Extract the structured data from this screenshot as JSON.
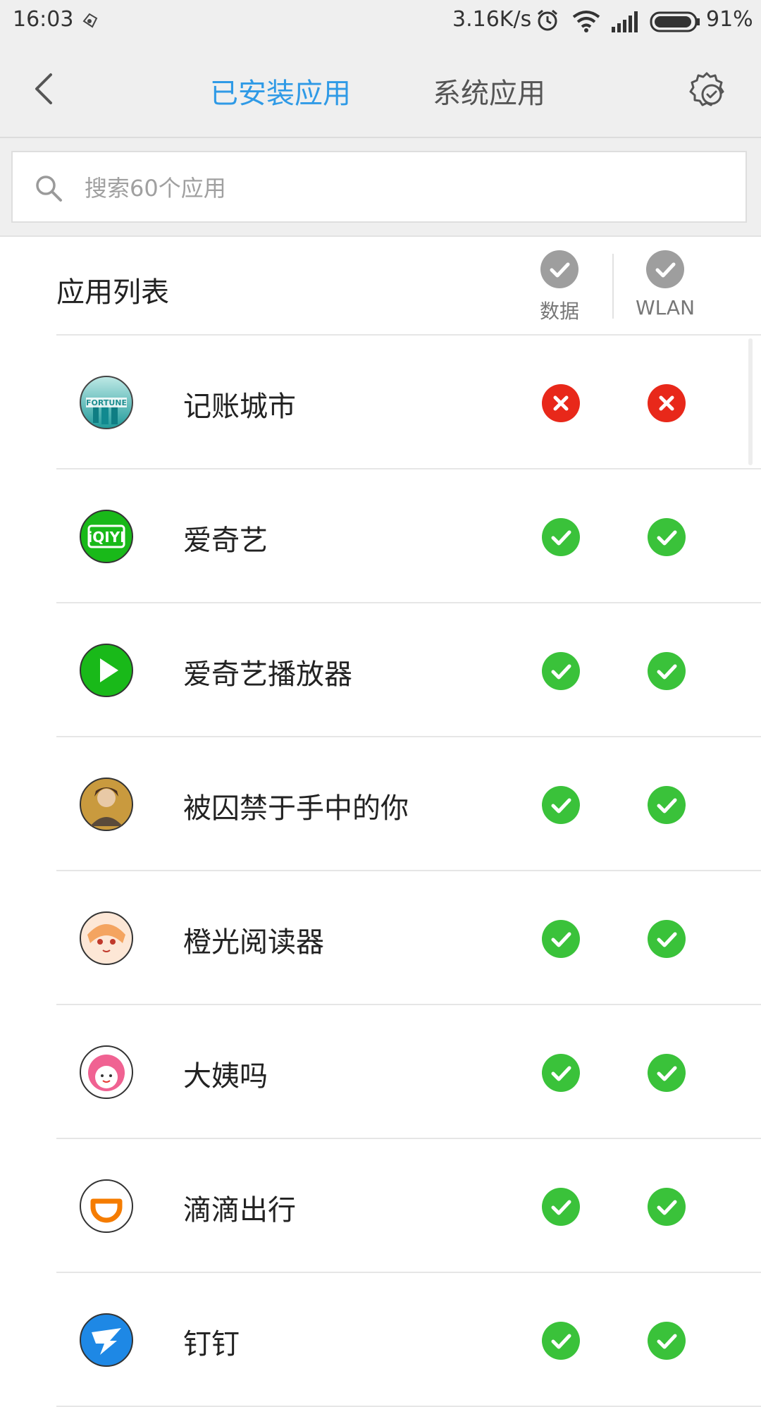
{
  "status_bar": {
    "time": "16:03",
    "network_speed": "3.16K/s",
    "battery_percent": "91%",
    "icons": [
      "notification-icon",
      "alarm-icon",
      "wifi-icon",
      "signal-icon",
      "battery-icon"
    ]
  },
  "header": {
    "tabs": [
      {
        "label": "已安装应用",
        "active": true
      },
      {
        "label": "系统应用",
        "active": false
      }
    ],
    "accent_color": "#2f9ae6"
  },
  "search": {
    "placeholder": "搜索60个应用",
    "value": ""
  },
  "list_header": {
    "title": "应用列表",
    "col_data": "数据",
    "col_wlan": "WLAN"
  },
  "colors": {
    "allowed": "#3ac23a",
    "blocked": "#e8281a",
    "header_check": "#9e9e9e"
  },
  "apps": [
    {
      "name": "记账城市",
      "icon": "fortune-city-icon",
      "data": false,
      "wlan": false
    },
    {
      "name": "爱奇艺",
      "icon": "iqiyi-icon",
      "data": true,
      "wlan": true
    },
    {
      "name": "爱奇艺播放器",
      "icon": "iqiyi-player-icon",
      "data": true,
      "wlan": true
    },
    {
      "name": "被囚禁于手中的你",
      "icon": "game-portrait-icon",
      "data": true,
      "wlan": true
    },
    {
      "name": "橙光阅读器",
      "icon": "orange-light-reader-icon",
      "data": true,
      "wlan": true
    },
    {
      "name": "大姨吗",
      "icon": "dayima-icon",
      "data": true,
      "wlan": true
    },
    {
      "name": "滴滴出行",
      "icon": "didi-icon",
      "data": true,
      "wlan": true
    },
    {
      "name": "钉钉",
      "icon": "dingtalk-icon",
      "data": true,
      "wlan": true
    }
  ]
}
